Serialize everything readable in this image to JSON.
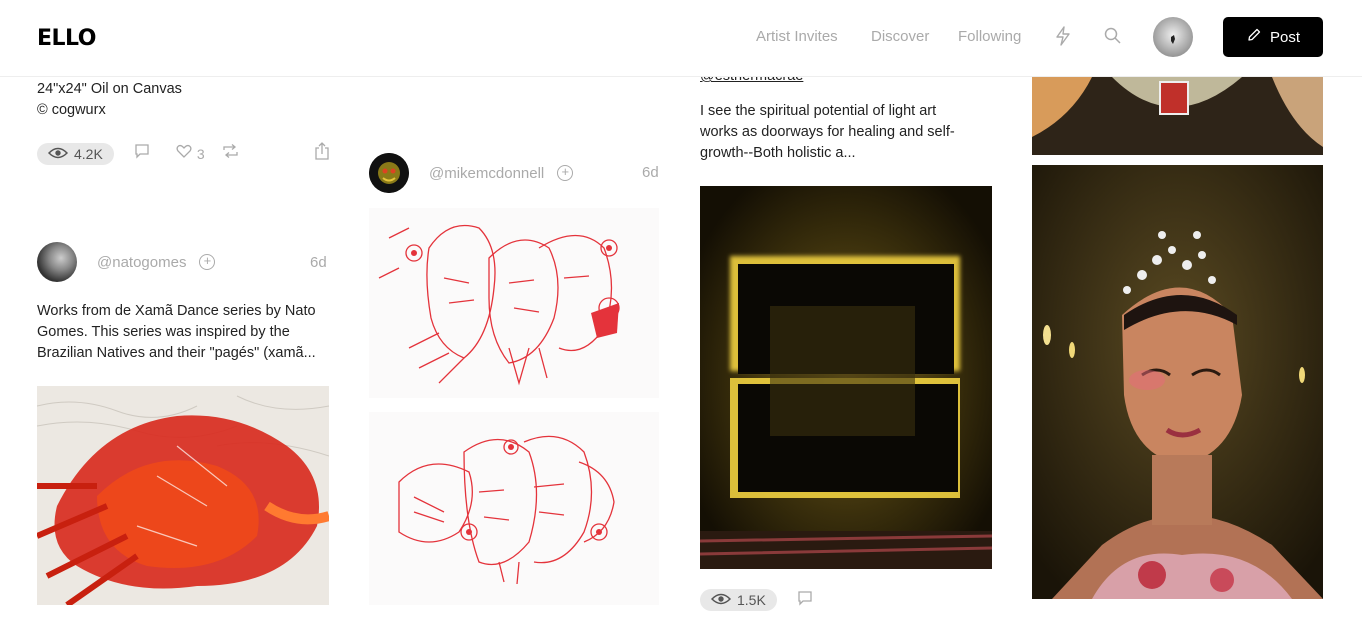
{
  "header": {
    "logo": "ELLO",
    "nav": [
      "Artist Invites",
      "Discover",
      "Following"
    ],
    "post_label": "Post"
  },
  "col1": {
    "caption_line1": "24\"x24\" Oil on Canvas",
    "caption_line2": "© cogwurx",
    "views": "4.2K",
    "loves": "3",
    "post2": {
      "username": "@natogomes",
      "timeago": "6d",
      "body_line1": "Works from de Xamã Dance series by Nato",
      "body_line2": "Gomes. This series was inspired by the",
      "body_line3": "Brazilian Natives and their \"pagés\" (xamã..."
    }
  },
  "col2": {
    "username": "@mikemcdonnell",
    "timeago": "6d"
  },
  "col3": {
    "mention": "@esthermacrae",
    "body_line1": "I see the spiritual potential of light art",
    "body_line2": "works as doorways for healing and self-",
    "body_line3": "growth--Both holistic a...",
    "views": "1.5K"
  },
  "icons": {
    "bolt": "bolt-icon",
    "search": "search-icon",
    "eye": "eye-icon",
    "comment": "comment-icon",
    "heart": "heart-icon",
    "repost": "repost-icon",
    "share": "share-icon",
    "pencil": "pencil-icon"
  }
}
